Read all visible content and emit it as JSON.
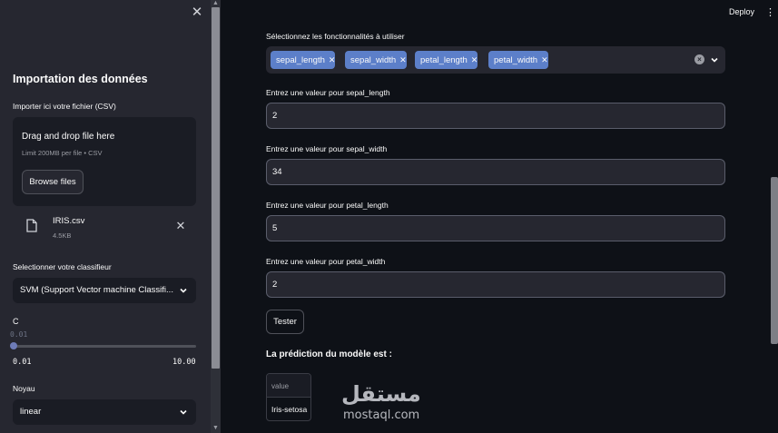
{
  "sidebar": {
    "close_icon": "close-icon",
    "title": "Importation des données",
    "upload_label": "Importer ici votre fichier (CSV)",
    "dropzone": {
      "title": "Drag and drop file here",
      "subtitle": "Limit 200MB per file • CSV",
      "browse_label": "Browse files"
    },
    "file": {
      "name": "IRIS.csv",
      "size": "4.5KB",
      "icon": "file-icon"
    },
    "classifier_label": "Selectionner votre classifieur",
    "classifier_value": "SVM (Support Vector machine Classifi...",
    "c_label": "C",
    "c_value": "0.01",
    "c_fraction": 0,
    "c_min": "0.01",
    "c_max": "10.00",
    "kernel_label": "Noyau",
    "kernel_value": "linear"
  },
  "header": {
    "deploy_label": "Deploy",
    "menu_icon": "kebab-menu-icon"
  },
  "main": {
    "features_label": "Sélectionnez les fonctionnalités à utiliser",
    "features": [
      "sepal_length",
      "sepal_width",
      "petal_length",
      "petal_width"
    ],
    "inputs": [
      {
        "label": "Entrez une valeur pour sepal_length",
        "value": "2"
      },
      {
        "label": "Entrez une valeur pour sepal_width",
        "value": "34"
      },
      {
        "label": "Entrez une valeur pour petal_length",
        "value": "5"
      },
      {
        "label": "Entrez une valeur pour petal_width",
        "value": "2"
      }
    ],
    "tester_label": "Tester",
    "prediction_label": "La prédiction du modèle est :",
    "table": {
      "header": "value",
      "cell": "Iris-setosa"
    }
  },
  "watermark": {
    "arabic": "مستقل",
    "latin": "mostaql.com"
  },
  "colors": {
    "background": "#0e1117",
    "sidebar": "#262730",
    "chip": "#5c7fc9",
    "slider_thumb": "#6e7cb8"
  }
}
